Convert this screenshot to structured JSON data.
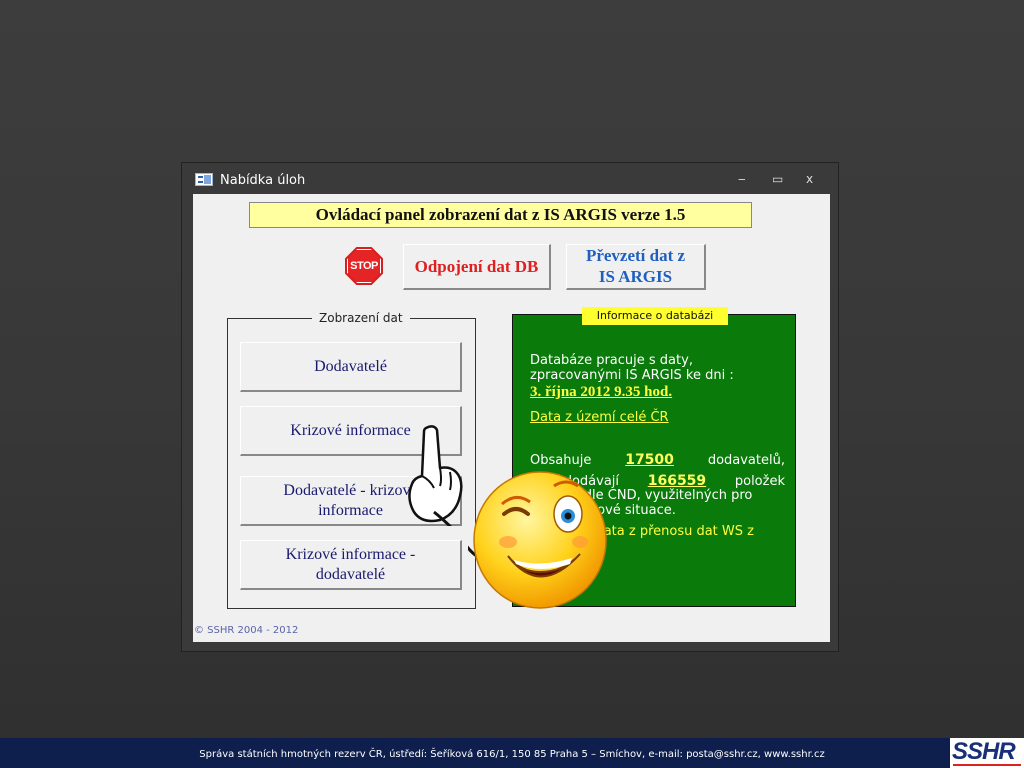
{
  "window": {
    "title": "Nabídka úloh",
    "controls": {
      "minimize": "‒",
      "maximize": "▭",
      "close": "x"
    }
  },
  "header": {
    "banner": "Ovládací panel zobrazení dat z IS ARGIS verze 1.5"
  },
  "toolbar": {
    "stop_icon_text": "STOP",
    "disconnect_label": "Odpojení dat DB",
    "transfer_label_line1": "Převzetí dat z",
    "transfer_label_line2": "IS ARGIS"
  },
  "data_view": {
    "label": "Zobrazení dat",
    "buttons": [
      {
        "line1": "Dodavatelé",
        "line2": ""
      },
      {
        "line1": "Krizové informace",
        "line2": ""
      },
      {
        "line1": "Dodavatelé - krizové",
        "line2": "informace"
      },
      {
        "line1": "Krizové informace -",
        "line2": "dodavatelé"
      }
    ]
  },
  "info": {
    "title": "Informace o databázi",
    "intro": "Databáze pracuje s daty, zpracovanými IS ARGIS ke dni :",
    "date": "3. října 2012 9.35 hod.",
    "region": "Data z území celé ČR",
    "row1": {
      "prefix": "Obsahuje",
      "value": "17500",
      "suffix": "dodavatelů,"
    },
    "row2": {
      "prefix": "kteří dodávají",
      "value": "166559",
      "suffix": "položek"
    },
    "line3": "zboží podle CND, využitelných pro řešení krizové situace.",
    "line4": "Obsahuje data z přenosu dat WS z"
  },
  "copyright": "© SSHR 2004 - 2012",
  "footer": {
    "text": "Správa státních hmotných rezerv ČR, ústředí: Šeříková 616/1, 150 85 Praha 5 – Smíchov, e-mail: posta@sshr.cz, www.sshr.cz",
    "logo": "SSHR"
  },
  "colors": {
    "info_panel": "#0a7a0a",
    "banner": "#ffff9f",
    "accent_red": "#e02020",
    "accent_blue": "#1f5fc0",
    "footer_bg": "#0e1f4e"
  }
}
